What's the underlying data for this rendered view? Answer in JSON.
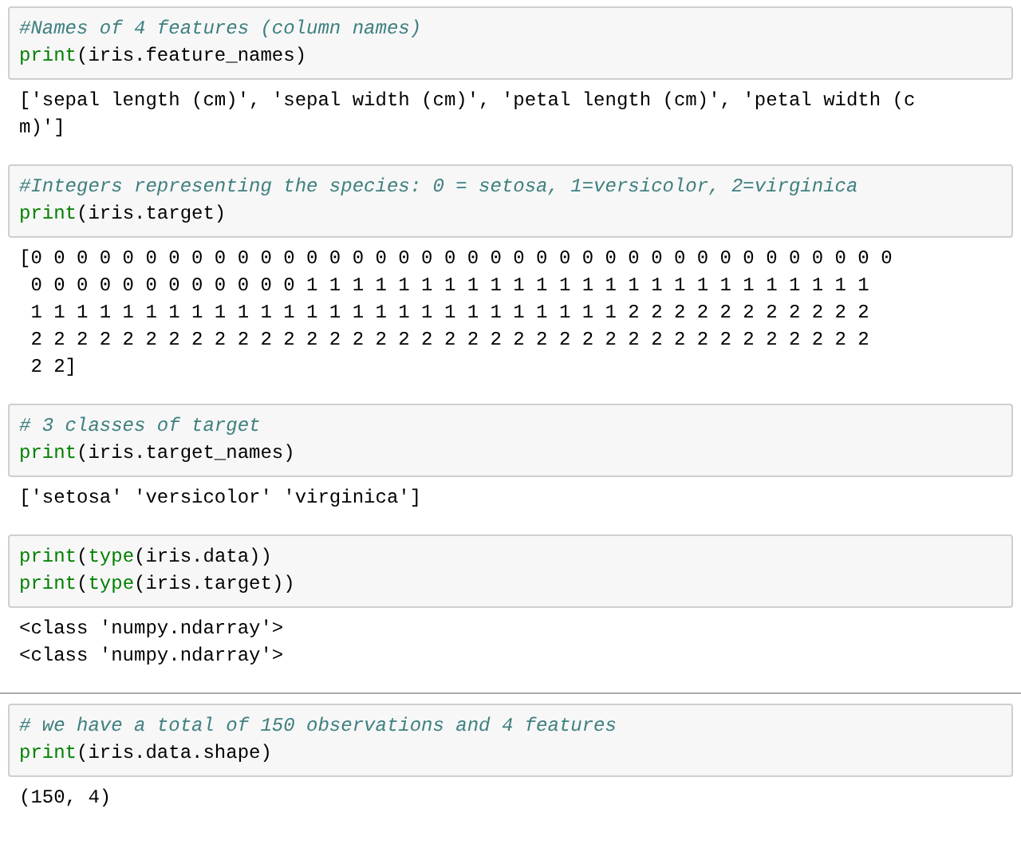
{
  "cells": [
    {
      "selected": false,
      "input": [
        [
          {
            "kind": "comment",
            "text": "#Names of 4 features (column names)"
          }
        ],
        [
          {
            "kind": "builtin",
            "text": "print"
          },
          {
            "kind": "plain",
            "text": "(iris.feature_names)"
          }
        ]
      ],
      "output": [
        "['sepal length (cm)', 'sepal width (cm)', 'petal length (cm)', 'petal width (c",
        "m)']"
      ]
    },
    {
      "selected": false,
      "input": [
        [
          {
            "kind": "comment",
            "text": "#Integers representing the species: 0 = setosa, 1=versicolor, 2=virginica"
          }
        ],
        [
          {
            "kind": "builtin",
            "text": "print"
          },
          {
            "kind": "plain",
            "text": "(iris.target)"
          }
        ]
      ],
      "output": [
        "[0 0 0 0 0 0 0 0 0 0 0 0 0 0 0 0 0 0 0 0 0 0 0 0 0 0 0 0 0 0 0 0 0 0 0 0 0 0",
        " 0 0 0 0 0 0 0 0 0 0 0 0 1 1 1 1 1 1 1 1 1 1 1 1 1 1 1 1 1 1 1 1 1 1 1 1 1",
        " 1 1 1 1 1 1 1 1 1 1 1 1 1 1 1 1 1 1 1 1 1 1 1 1 1 1 2 2 2 2 2 2 2 2 2 2 2",
        " 2 2 2 2 2 2 2 2 2 2 2 2 2 2 2 2 2 2 2 2 2 2 2 2 2 2 2 2 2 2 2 2 2 2 2 2 2",
        " 2 2]"
      ]
    },
    {
      "selected": false,
      "input": [
        [
          {
            "kind": "comment",
            "text": "# 3 classes of target"
          }
        ],
        [
          {
            "kind": "builtin",
            "text": "print"
          },
          {
            "kind": "plain",
            "text": "(iris.target_names)"
          }
        ]
      ],
      "output": [
        "['setosa' 'versicolor' 'virginica']"
      ]
    },
    {
      "selected": false,
      "input": [
        [
          {
            "kind": "builtin",
            "text": "print"
          },
          {
            "kind": "plain",
            "text": "("
          },
          {
            "kind": "builtin",
            "text": "type"
          },
          {
            "kind": "plain",
            "text": "(iris.data))"
          }
        ],
        [
          {
            "kind": "builtin",
            "text": "print"
          },
          {
            "kind": "plain",
            "text": "("
          },
          {
            "kind": "builtin",
            "text": "type"
          },
          {
            "kind": "plain",
            "text": "(iris.target))"
          }
        ]
      ],
      "output": [
        "<class 'numpy.ndarray'>",
        "<class 'numpy.ndarray'>"
      ]
    },
    {
      "selected": true,
      "input": [
        [
          {
            "kind": "comment",
            "text": "# we have a total of 150 observations and 4 features"
          }
        ],
        [
          {
            "kind": "builtin",
            "text": "print"
          },
          {
            "kind": "plain",
            "text": "(iris.data.shape)"
          }
        ]
      ],
      "output": [
        "(150, 4)"
      ]
    }
  ]
}
